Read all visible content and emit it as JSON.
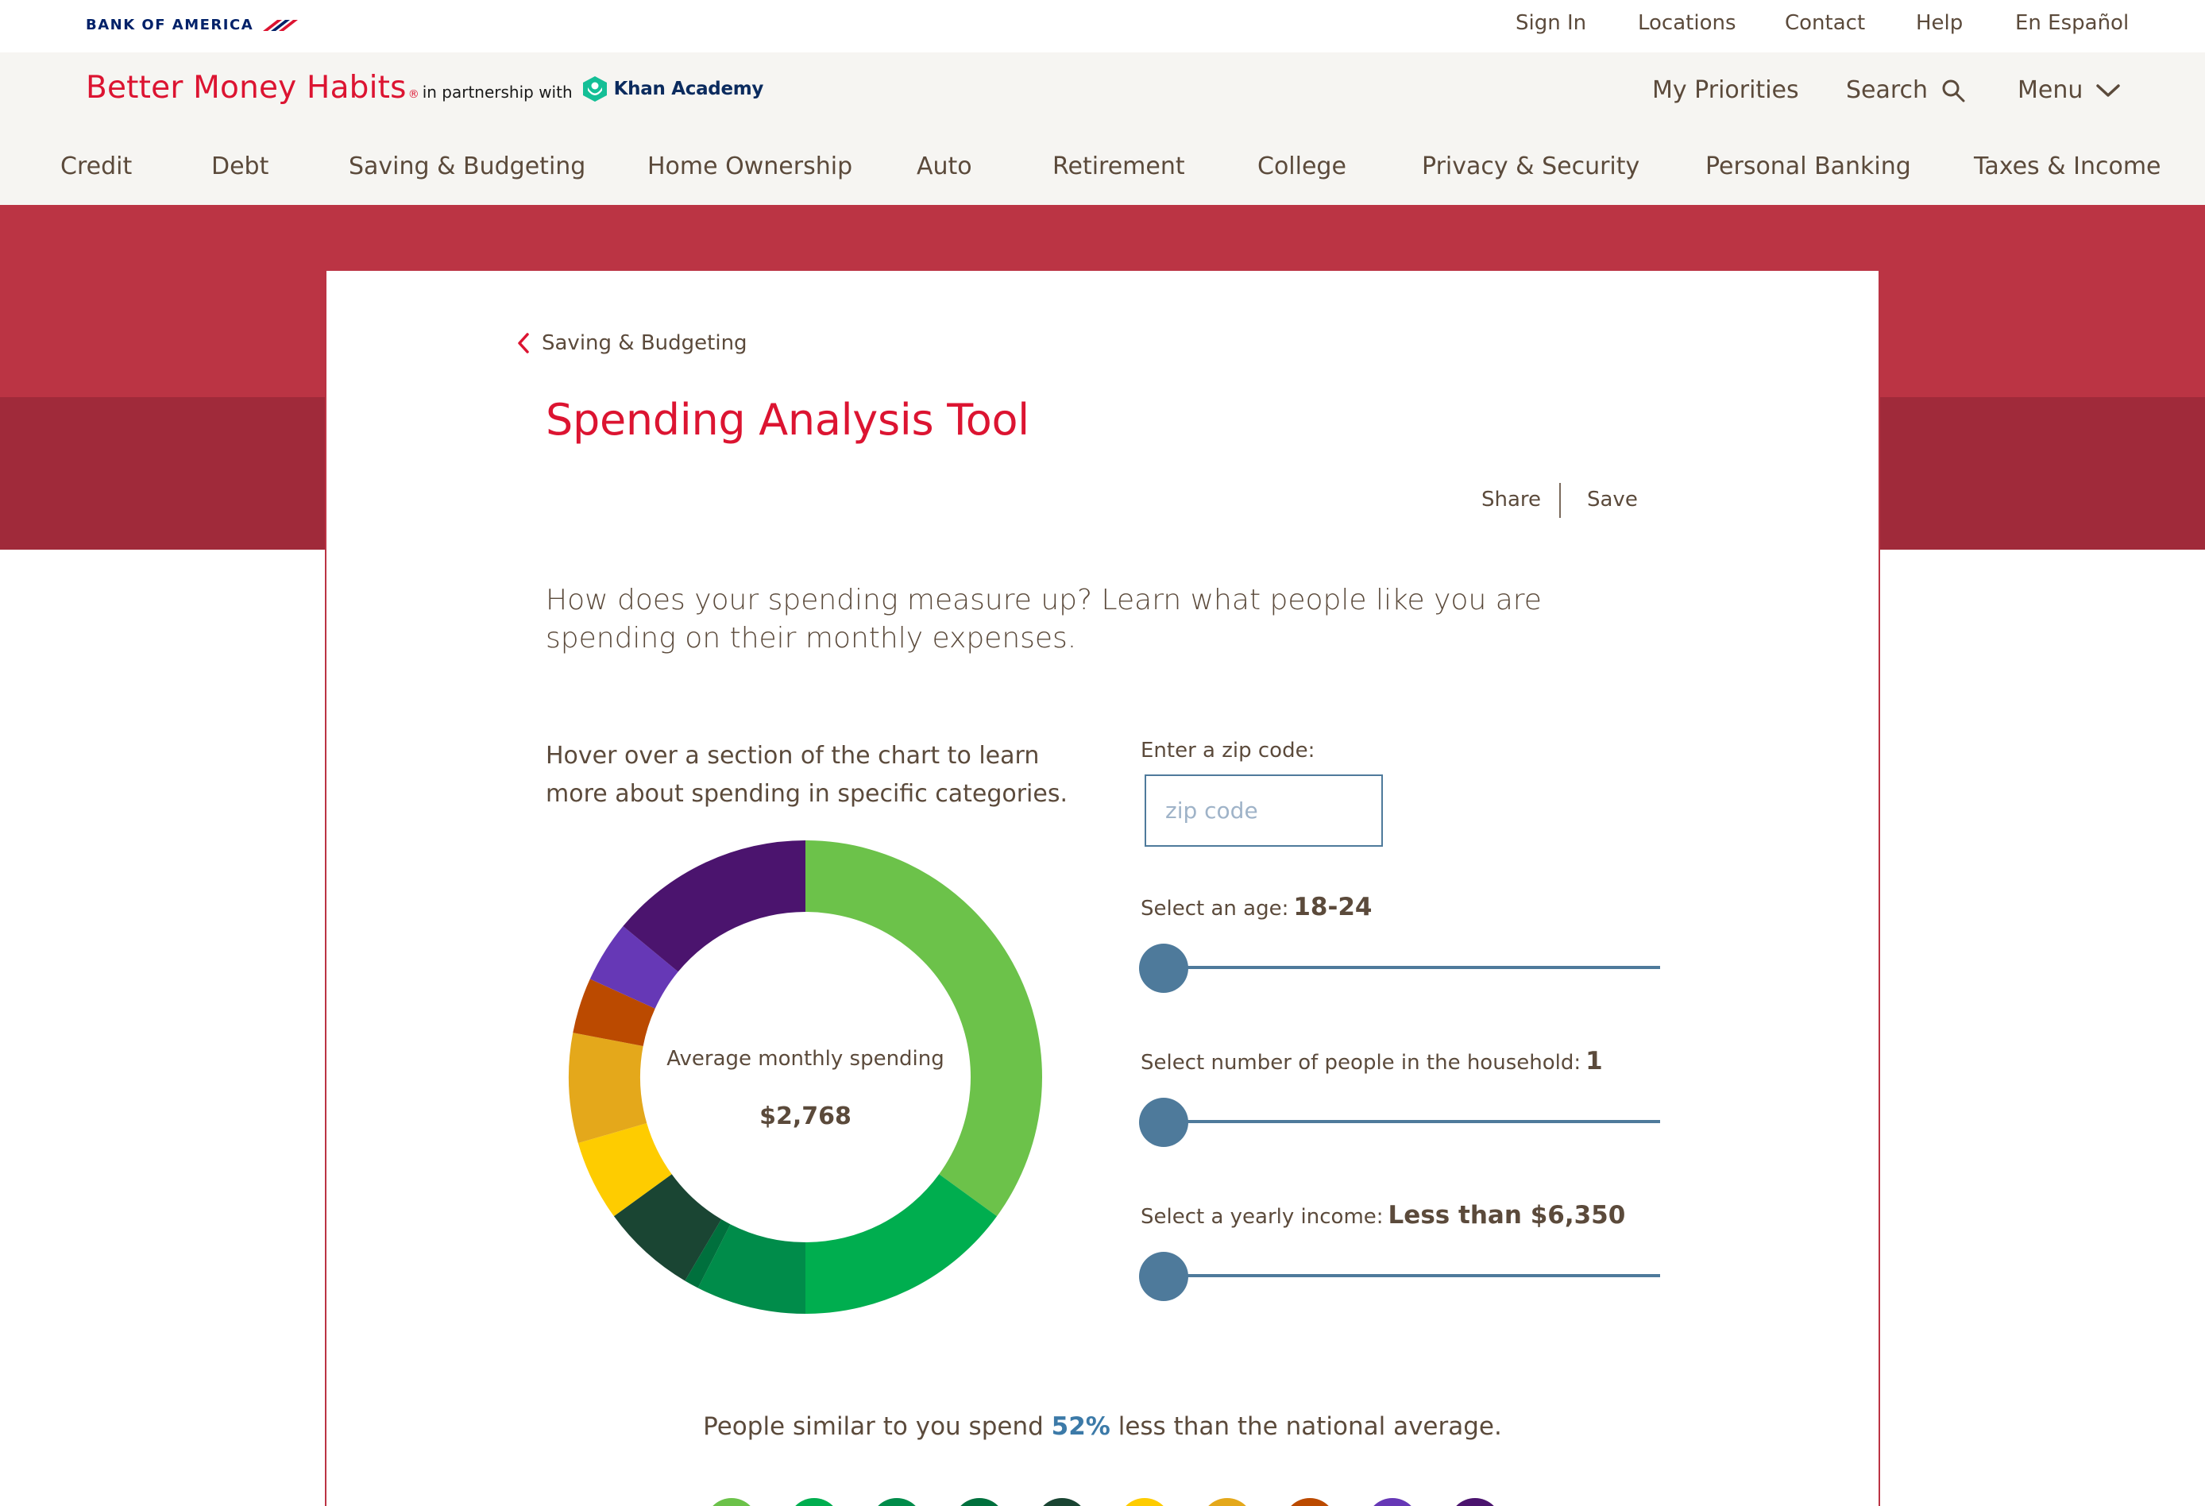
{
  "utility_nav": {
    "logo_text": "BANK OF AMERICA",
    "sign_in": "Sign In",
    "locations": "Locations",
    "contact": "Contact",
    "help": "Help",
    "espanol": "En Español"
  },
  "brand": {
    "name": "Better Money Habits",
    "registered": "®",
    "partner_text": "in partnership with",
    "partner_name": "Khan Academy",
    "my_priorities": "My Priorities",
    "search": "Search",
    "menu": "Menu"
  },
  "main_nav": [
    "Credit",
    "Debt",
    "Saving & Budgeting",
    "Home Ownership",
    "Auto",
    "Retirement",
    "College",
    "Privacy & Security",
    "Personal Banking",
    "Taxes & Income"
  ],
  "page": {
    "breadcrumb": "Saving & Budgeting",
    "title": "Spending Analysis Tool",
    "share": "Share",
    "save": "Save",
    "intro": "How does your spending measure up? Learn what people like you are spending on their monthly expenses.",
    "hover_hint": "Hover over a section of the chart to learn more about spending in specific categories."
  },
  "chart": {
    "caption": "Average monthly spending",
    "total": "$2,768"
  },
  "chart_data": {
    "type": "pie",
    "center_label": "Average monthly spending",
    "center_value": "$2,768",
    "slices": [
      {
        "value": 35.0,
        "color": "#6cc24a"
      },
      {
        "value": 15.0,
        "color": "#00ae4f"
      },
      {
        "value": 7.5,
        "color": "#008c4a"
      },
      {
        "value": 1.0,
        "color": "#00703d"
      },
      {
        "value": 6.5,
        "color": "#1a4533"
      },
      {
        "value": 5.5,
        "color": "#fecc00"
      },
      {
        "value": 7.5,
        "color": "#e4a81b"
      },
      {
        "value": 3.8,
        "color": "#bb4a00"
      },
      {
        "value": 4.2,
        "color": "#6638b6"
      },
      {
        "value": 14.0,
        "color": "#4b146e"
      }
    ]
  },
  "form": {
    "zip_label": "Enter a zip code:",
    "zip_placeholder": "zip code",
    "zip_value": "",
    "age_label": "Select an age:",
    "age_value": "18-24",
    "age_level": 0,
    "household_label": "Select number of people in the household:",
    "household_value": "1",
    "household_level": 0,
    "income_label": "Select a yearly income:",
    "income_value": "Less than $6,350",
    "income_level": 0
  },
  "summary": {
    "prefix": "People similar to you spend",
    "percent": "52%",
    "suffix": "less than the national average."
  },
  "legend_colors": [
    "#6cc24a",
    "#00ae4f",
    "#008c4a",
    "#00703d",
    "#1a4533",
    "#fecc00",
    "#e4a81b",
    "#bb4a00",
    "#6638b6",
    "#4b146e"
  ]
}
